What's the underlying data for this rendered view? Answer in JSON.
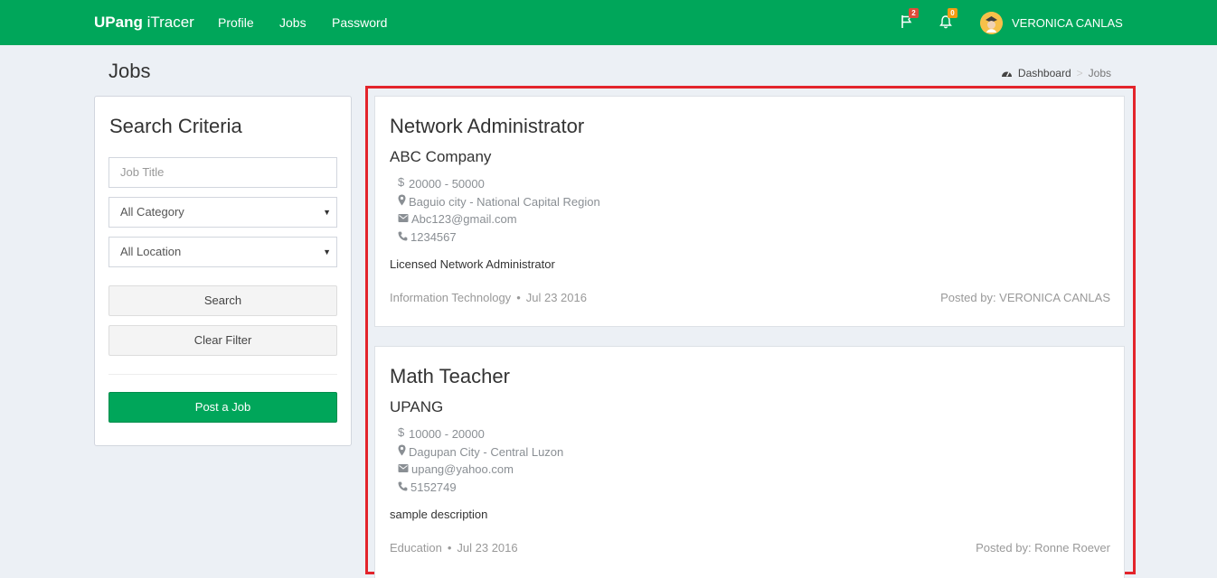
{
  "navbar": {
    "brand_bold": "UPang",
    "brand_light": " iTracer",
    "links": {
      "profile": "Profile",
      "jobs": "Jobs",
      "password": "Password"
    },
    "flag_badge": "2",
    "bell_badge": "0",
    "user_name": "VERONICA CANLAS",
    "icons": [
      "flag-icon",
      "bell-icon",
      "avatar"
    ],
    "colors": {
      "navbar": "#00a65a",
      "badge_red": "#dd4b39",
      "badge_yellow": "#f39c12"
    }
  },
  "header": {
    "title": "Jobs",
    "breadcrumb": {
      "home": "Dashboard",
      "sep": ">",
      "current": "Jobs"
    }
  },
  "sidebar": {
    "title": "Search Criteria",
    "job_title_placeholder": "Job Title",
    "category_selected": "All Category",
    "location_selected": "All Location",
    "search_label": "Search",
    "clear_label": "Clear Filter",
    "post_label": "Post a Job"
  },
  "jobs": [
    {
      "title": "Network Administrator",
      "company": "ABC Company",
      "salary": "20000 - 50000",
      "location": "Baguio city - National Capital Region",
      "email": "Abc123@gmail.com",
      "phone": "1234567",
      "description": "Licensed Network Administrator",
      "category": "Information Technology",
      "date": "Jul 23 2016",
      "posted_by": "Posted by: VERONICA CANLAS"
    },
    {
      "title": "Math Teacher",
      "company": "UPANG",
      "salary": "10000 - 20000",
      "location": "Dagupan City - Central Luzon",
      "email": "upang@yahoo.com",
      "phone": "5152749",
      "description": "sample description",
      "category": "Education",
      "date": "Jul 23 2016",
      "posted_by": "Posted by: Ronne Roever"
    }
  ]
}
